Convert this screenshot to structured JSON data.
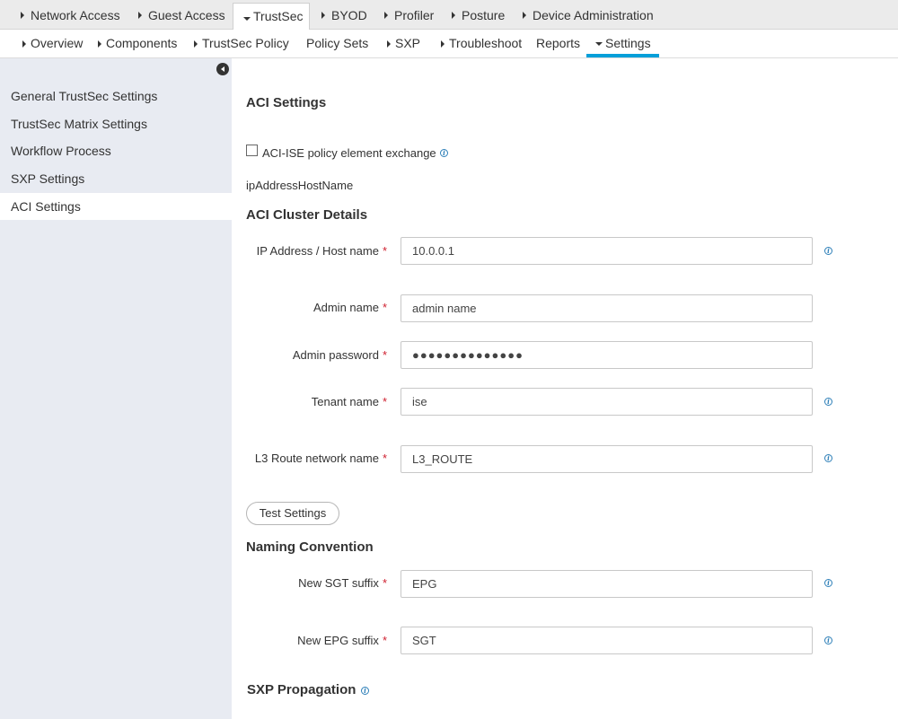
{
  "top_nav": {
    "items": [
      {
        "label": "Network Access"
      },
      {
        "label": "Guest Access"
      },
      {
        "label": "TrustSec"
      },
      {
        "label": "BYOD"
      },
      {
        "label": "Profiler"
      },
      {
        "label": "Posture"
      },
      {
        "label": "Device Administration"
      }
    ],
    "active": "TrustSec"
  },
  "sub_nav": {
    "items": [
      {
        "label": "Overview"
      },
      {
        "label": "Components"
      },
      {
        "label": "TrustSec Policy"
      },
      {
        "label": "Policy Sets"
      },
      {
        "label": "SXP"
      },
      {
        "label": "Troubleshoot"
      },
      {
        "label": "Reports"
      },
      {
        "label": "Settings"
      }
    ],
    "active": "Settings"
  },
  "sidebar": {
    "items": [
      {
        "label": "General TrustSec Settings"
      },
      {
        "label": "TrustSec Matrix Settings"
      },
      {
        "label": "Workflow Process"
      },
      {
        "label": "SXP Settings"
      },
      {
        "label": "ACI Settings"
      }
    ],
    "active": "ACI Settings"
  },
  "main": {
    "title": "ACI Settings",
    "exchange_checkbox_label": "ACI-ISE policy element exchange",
    "raw_key_text": "ipAddressHostName",
    "cluster_heading": "ACI Cluster Details",
    "fields": {
      "ip": {
        "label": "IP Address / Host name",
        "value": "10.0.0.1"
      },
      "admin_name": {
        "label": "Admin name",
        "value": "admin name"
      },
      "admin_password": {
        "label": "Admin password",
        "value": "●●●●●●●●●●●●●●"
      },
      "tenant": {
        "label": "Tenant name",
        "value": "ise"
      },
      "l3": {
        "label": "L3 Route network name",
        "value": "L3_ROUTE"
      },
      "sgt_suffix": {
        "label": "New SGT suffix",
        "value": "EPG"
      },
      "epg_suffix": {
        "label": "New EPG suffix",
        "value": "SGT"
      }
    },
    "required_mark": "*",
    "test_button": "Test Settings",
    "naming_heading": "Naming Convention",
    "sxp_heading": "SXP Propagation",
    "info_glyph": "i"
  },
  "colors": {
    "accent": "#049fd9",
    "required": "#cf2030",
    "info": "#2d7fb8",
    "sidebar_bg": "#e8ebf2"
  }
}
